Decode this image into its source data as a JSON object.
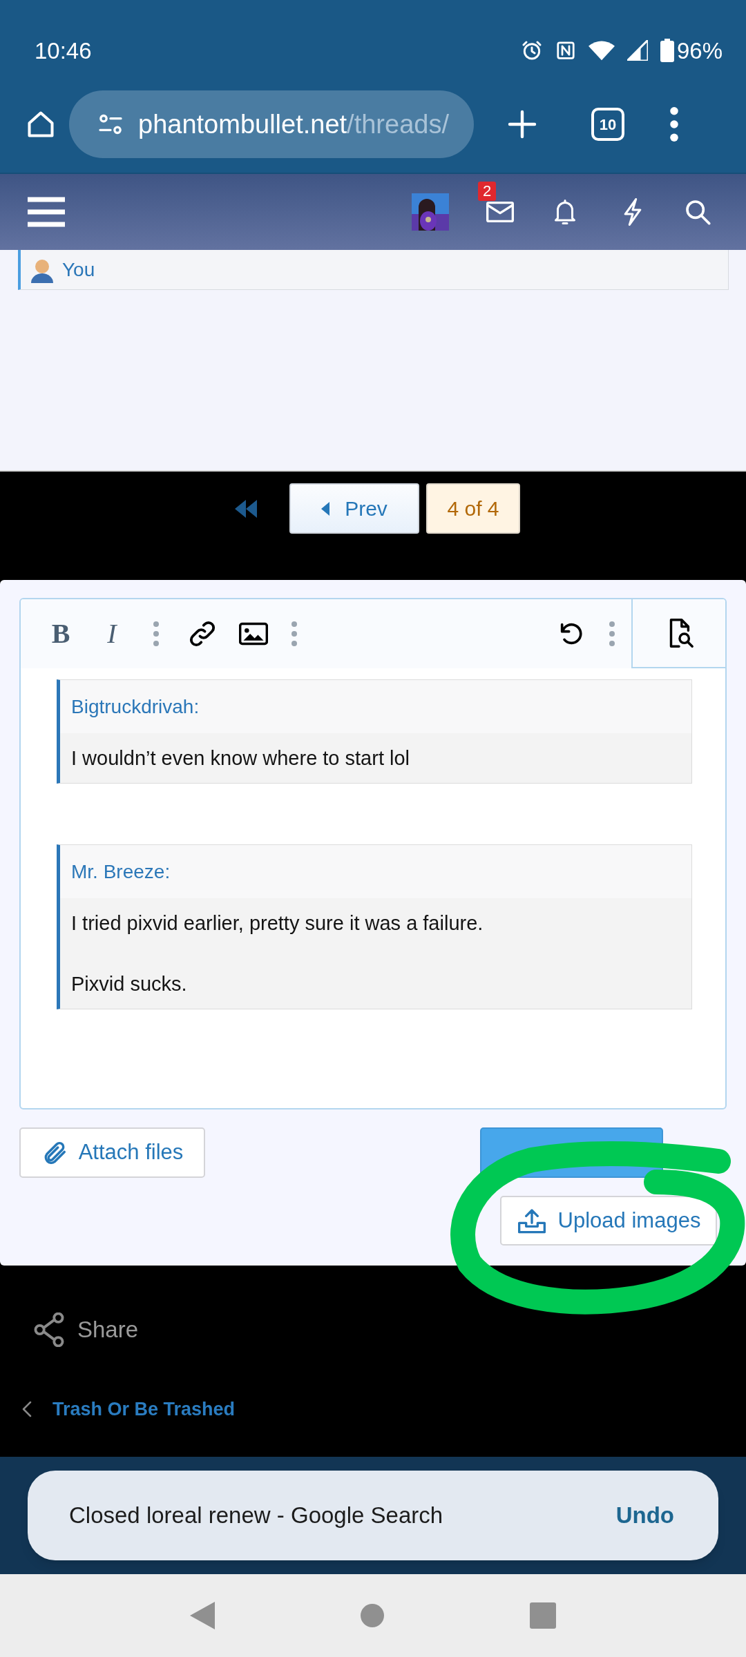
{
  "status_bar": {
    "time": "10:46",
    "battery": "96%"
  },
  "browser": {
    "url_host": "phantombullet.net",
    "url_path": "/threads/",
    "tab_count": "10"
  },
  "forum_nav": {
    "inbox_badge": "2"
  },
  "previous_quote": {
    "author": "You"
  },
  "pagination": {
    "prev": "Prev",
    "current": "4 of 4"
  },
  "editor": {
    "toolbar": {
      "bold": "B",
      "italic": "I"
    },
    "quotes": [
      {
        "author": "Bigtruckdrivah:",
        "paragraphs": [
          "I wouldn’t even know where to start lol"
        ]
      },
      {
        "author": "Mr. Breeze:",
        "paragraphs": [
          "I tried pixvid earlier, pretty sure it was a failure.",
          "Pixvid sucks."
        ]
      }
    ]
  },
  "buttons": {
    "attach": "Attach files",
    "upload": "Upload images"
  },
  "share": "Share",
  "breadcrumb": "Trash Or Be Trashed",
  "toast": {
    "message": "Closed loreal renew - Google Search",
    "action": "Undo"
  }
}
